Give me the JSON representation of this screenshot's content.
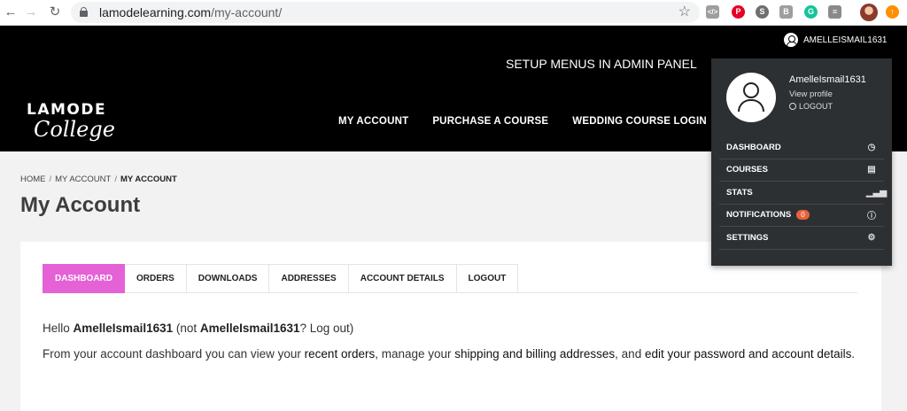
{
  "browser": {
    "url_host": "lamodelearning.com",
    "url_path": "/my-account/"
  },
  "header": {
    "username": "AMELLEISMAIL1631",
    "setup_menus": "SETUP MENUS IN ADMIN PANEL",
    "logo_line1": "LAMODE",
    "logo_line2": "College",
    "nav": [
      {
        "label": "MY ACCOUNT"
      },
      {
        "label": "PURCHASE A COURSE"
      },
      {
        "label": "WEDDING COURSE LOGIN"
      }
    ]
  },
  "breadcrumb": {
    "home": "HOME",
    "parent": "MY ACCOUNT",
    "current": "MY ACCOUNT",
    "separator": "/"
  },
  "page": {
    "title": "My Account"
  },
  "tabs": [
    {
      "label": "DASHBOARD",
      "active": true
    },
    {
      "label": "ORDERS"
    },
    {
      "label": "DOWNLOADS"
    },
    {
      "label": "ADDRESSES"
    },
    {
      "label": "ACCOUNT DETAILS"
    },
    {
      "label": "LOGOUT"
    }
  ],
  "dashboard": {
    "hello_prefix": "Hello",
    "hello_name": "AmelleIsmail1631",
    "hello_not": "(not",
    "hello_name2": "AmelleIsmail1631",
    "hello_logout": "? Log out)",
    "intro_1": "From your account dashboard you can view your",
    "link_orders": "recent orders",
    "intro_2": ", manage your",
    "link_addresses": "shipping and billing addresses",
    "intro_3": ", and",
    "link_password": "edit your password and account details",
    "intro_4": "."
  },
  "dropdown": {
    "name": "AmelleIsmail1631",
    "view_profile": "View profile",
    "logout": "LOGOUT",
    "items": [
      {
        "label": "DASHBOARD",
        "icon": "dashboard-icon"
      },
      {
        "label": "COURSES",
        "icon": "book-icon"
      },
      {
        "label": "STATS",
        "icon": "signal-icon"
      },
      {
        "label": "NOTIFICATIONS",
        "icon": "info-icon",
        "badge": "0"
      },
      {
        "label": "SETTINGS",
        "icon": "gear-icon"
      }
    ]
  },
  "colors": {
    "accent": "#e561d6",
    "header_bg": "#000000",
    "dropdown_bg": "#2c3033",
    "badge": "#e8613c"
  }
}
